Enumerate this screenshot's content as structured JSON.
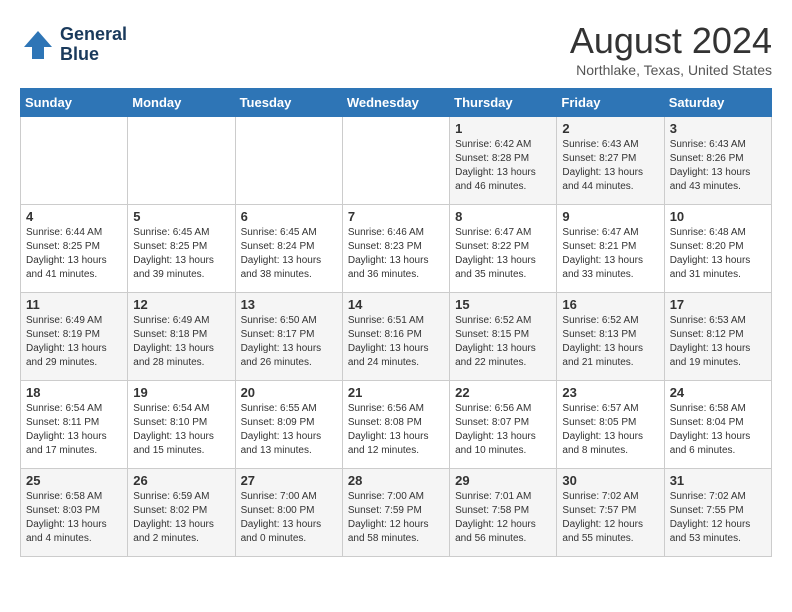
{
  "header": {
    "logo_line1": "General",
    "logo_line2": "Blue",
    "month_title": "August 2024",
    "location": "Northlake, Texas, United States"
  },
  "weekdays": [
    "Sunday",
    "Monday",
    "Tuesday",
    "Wednesday",
    "Thursday",
    "Friday",
    "Saturday"
  ],
  "weeks": [
    [
      {
        "day": "",
        "info": ""
      },
      {
        "day": "",
        "info": ""
      },
      {
        "day": "",
        "info": ""
      },
      {
        "day": "",
        "info": ""
      },
      {
        "day": "1",
        "info": "Sunrise: 6:42 AM\nSunset: 8:28 PM\nDaylight: 13 hours\nand 46 minutes."
      },
      {
        "day": "2",
        "info": "Sunrise: 6:43 AM\nSunset: 8:27 PM\nDaylight: 13 hours\nand 44 minutes."
      },
      {
        "day": "3",
        "info": "Sunrise: 6:43 AM\nSunset: 8:26 PM\nDaylight: 13 hours\nand 43 minutes."
      }
    ],
    [
      {
        "day": "4",
        "info": "Sunrise: 6:44 AM\nSunset: 8:25 PM\nDaylight: 13 hours\nand 41 minutes."
      },
      {
        "day": "5",
        "info": "Sunrise: 6:45 AM\nSunset: 8:25 PM\nDaylight: 13 hours\nand 39 minutes."
      },
      {
        "day": "6",
        "info": "Sunrise: 6:45 AM\nSunset: 8:24 PM\nDaylight: 13 hours\nand 38 minutes."
      },
      {
        "day": "7",
        "info": "Sunrise: 6:46 AM\nSunset: 8:23 PM\nDaylight: 13 hours\nand 36 minutes."
      },
      {
        "day": "8",
        "info": "Sunrise: 6:47 AM\nSunset: 8:22 PM\nDaylight: 13 hours\nand 35 minutes."
      },
      {
        "day": "9",
        "info": "Sunrise: 6:47 AM\nSunset: 8:21 PM\nDaylight: 13 hours\nand 33 minutes."
      },
      {
        "day": "10",
        "info": "Sunrise: 6:48 AM\nSunset: 8:20 PM\nDaylight: 13 hours\nand 31 minutes."
      }
    ],
    [
      {
        "day": "11",
        "info": "Sunrise: 6:49 AM\nSunset: 8:19 PM\nDaylight: 13 hours\nand 29 minutes."
      },
      {
        "day": "12",
        "info": "Sunrise: 6:49 AM\nSunset: 8:18 PM\nDaylight: 13 hours\nand 28 minutes."
      },
      {
        "day": "13",
        "info": "Sunrise: 6:50 AM\nSunset: 8:17 PM\nDaylight: 13 hours\nand 26 minutes."
      },
      {
        "day": "14",
        "info": "Sunrise: 6:51 AM\nSunset: 8:16 PM\nDaylight: 13 hours\nand 24 minutes."
      },
      {
        "day": "15",
        "info": "Sunrise: 6:52 AM\nSunset: 8:15 PM\nDaylight: 13 hours\nand 22 minutes."
      },
      {
        "day": "16",
        "info": "Sunrise: 6:52 AM\nSunset: 8:13 PM\nDaylight: 13 hours\nand 21 minutes."
      },
      {
        "day": "17",
        "info": "Sunrise: 6:53 AM\nSunset: 8:12 PM\nDaylight: 13 hours\nand 19 minutes."
      }
    ],
    [
      {
        "day": "18",
        "info": "Sunrise: 6:54 AM\nSunset: 8:11 PM\nDaylight: 13 hours\nand 17 minutes."
      },
      {
        "day": "19",
        "info": "Sunrise: 6:54 AM\nSunset: 8:10 PM\nDaylight: 13 hours\nand 15 minutes."
      },
      {
        "day": "20",
        "info": "Sunrise: 6:55 AM\nSunset: 8:09 PM\nDaylight: 13 hours\nand 13 minutes."
      },
      {
        "day": "21",
        "info": "Sunrise: 6:56 AM\nSunset: 8:08 PM\nDaylight: 13 hours\nand 12 minutes."
      },
      {
        "day": "22",
        "info": "Sunrise: 6:56 AM\nSunset: 8:07 PM\nDaylight: 13 hours\nand 10 minutes."
      },
      {
        "day": "23",
        "info": "Sunrise: 6:57 AM\nSunset: 8:05 PM\nDaylight: 13 hours\nand 8 minutes."
      },
      {
        "day": "24",
        "info": "Sunrise: 6:58 AM\nSunset: 8:04 PM\nDaylight: 13 hours\nand 6 minutes."
      }
    ],
    [
      {
        "day": "25",
        "info": "Sunrise: 6:58 AM\nSunset: 8:03 PM\nDaylight: 13 hours\nand 4 minutes."
      },
      {
        "day": "26",
        "info": "Sunrise: 6:59 AM\nSunset: 8:02 PM\nDaylight: 13 hours\nand 2 minutes."
      },
      {
        "day": "27",
        "info": "Sunrise: 7:00 AM\nSunset: 8:00 PM\nDaylight: 13 hours\nand 0 minutes."
      },
      {
        "day": "28",
        "info": "Sunrise: 7:00 AM\nSunset: 7:59 PM\nDaylight: 12 hours\nand 58 minutes."
      },
      {
        "day": "29",
        "info": "Sunrise: 7:01 AM\nSunset: 7:58 PM\nDaylight: 12 hours\nand 56 minutes."
      },
      {
        "day": "30",
        "info": "Sunrise: 7:02 AM\nSunset: 7:57 PM\nDaylight: 12 hours\nand 55 minutes."
      },
      {
        "day": "31",
        "info": "Sunrise: 7:02 AM\nSunset: 7:55 PM\nDaylight: 12 hours\nand 53 minutes."
      }
    ]
  ]
}
